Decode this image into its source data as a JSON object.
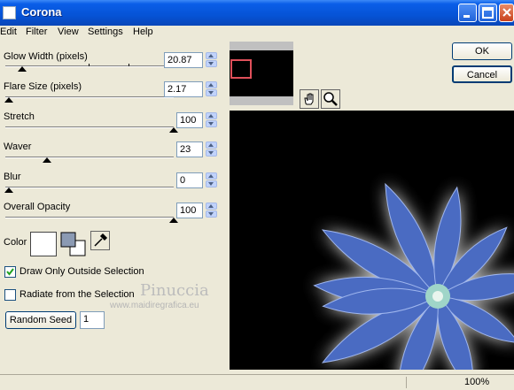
{
  "window": {
    "title": "Corona"
  },
  "menu": [
    "Edit",
    "Filter",
    "View",
    "Settings",
    "Help"
  ],
  "params": [
    {
      "label": "Glow Width (pixels)",
      "value": "20.87",
      "level": 0.08
    },
    {
      "label": "Flare Size (pixels)",
      "value": "2.17",
      "level": 0.0
    },
    {
      "label": "Stretch",
      "value": "100",
      "level": 1.0
    },
    {
      "label": "Waver",
      "value": "23",
      "level": 0.23
    },
    {
      "label": "Blur",
      "value": "0",
      "level": 0.0
    },
    {
      "label": "Overall Opacity",
      "value": "100",
      "level": 1.0
    }
  ],
  "color": {
    "label": "Color",
    "swatch": "#ffffff"
  },
  "options": {
    "draw_outside": {
      "label": "Draw Only Outside Selection",
      "checked": true
    },
    "radiate": {
      "label": "Radiate from the Selection",
      "checked": false
    }
  },
  "random_seed": {
    "label": "Random Seed",
    "value": "1"
  },
  "buttons": {
    "ok": "OK",
    "cancel": "Cancel"
  },
  "watermark": {
    "name": "Pinuccia",
    "url": "www.maidiregrafica.eu"
  },
  "status": {
    "zoom": "100%"
  },
  "colors": {
    "title_blue": "#0653d6",
    "preview_flower": "#4a6bc2"
  }
}
